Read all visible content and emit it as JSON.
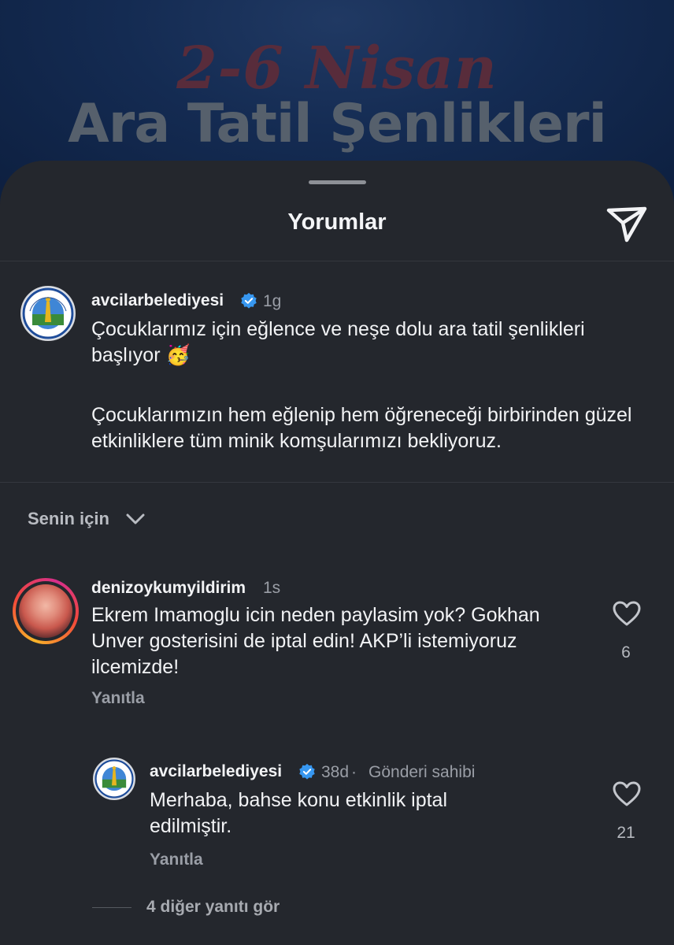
{
  "background": {
    "title_line1": "2-6 Nisan",
    "title_line2": "Ara Tatil Şenlikleri"
  },
  "sheet": {
    "title": "Yorumlar",
    "share_icon": "paper-plane-icon"
  },
  "post": {
    "username": "avcilarbelediyesi",
    "verified": true,
    "time": "1g",
    "avatar_text": [
      "AVCILAR",
      "BELEDİYE BAŞKANLIĞI"
    ],
    "caption_p1": "Çocuklarımız için eğlence ve neşe dolu ara tatil şenlikleri başlıyor 🥳",
    "caption_p2": "Çocuklarımızın hem eğlenip hem öğreneceği birbirinden güzel etkinliklere tüm minik komşularımızı bekliyoruz."
  },
  "filter": {
    "label": "Senin için"
  },
  "comments": [
    {
      "username": "denizoykumyildirim",
      "time": "1s",
      "text": "Ekrem Imamoglu icin neden paylasim yok? Gokhan Unver gosterisini de iptal edin! AKP’li istemiyoruz ilcemizde!",
      "reply_label": "Yanıtla",
      "likes": "6",
      "replies": [
        {
          "username": "avcilarbelediyesi",
          "verified": true,
          "time": "38d",
          "owner_tag": "Gönderi sahibi",
          "text": "Merhaba, bahse konu etkinlik iptal edilmiştir.",
          "reply_label": "Yanıtla",
          "likes": "21"
        }
      ],
      "more_replies_label": "4 diğer yanıtı gör"
    }
  ],
  "colors": {
    "sheet_bg": "#24272d",
    "verified_blue": "#3797f0",
    "muted_text": "#9a9ea6"
  }
}
